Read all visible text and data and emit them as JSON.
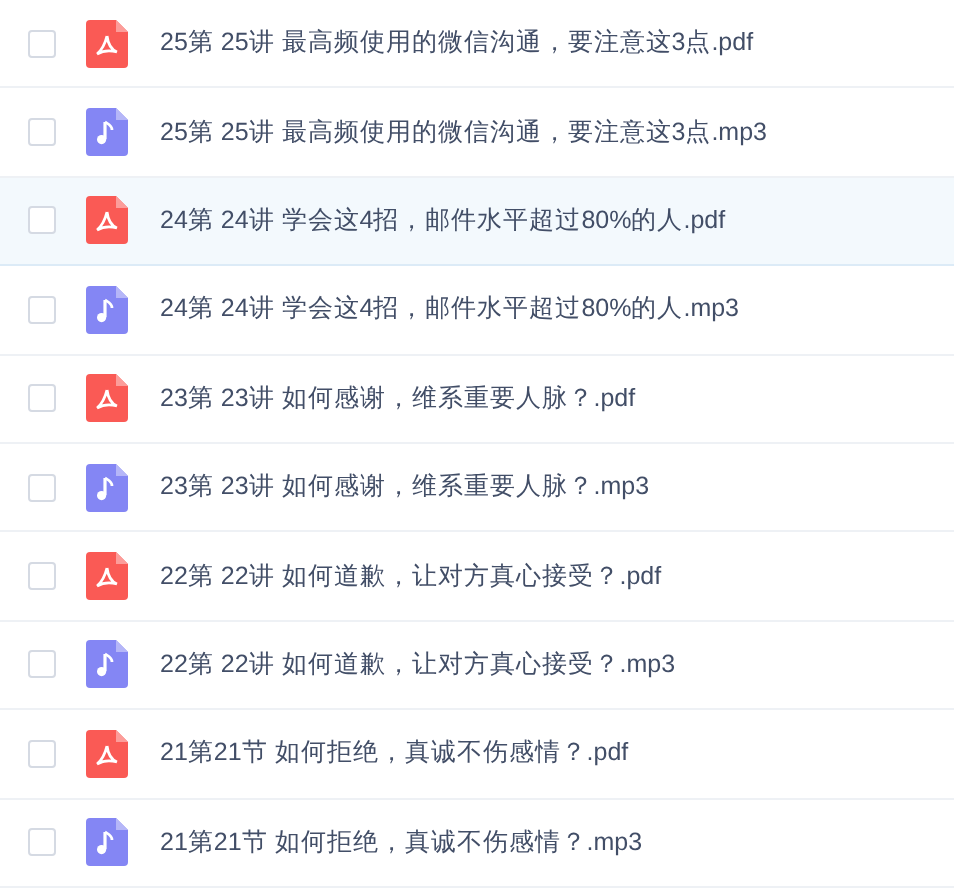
{
  "files": [
    {
      "kind": "pdf",
      "name": "25第 25讲 最高频使用的微信沟通，要注意这3点.pdf",
      "checked": false,
      "selected": false
    },
    {
      "kind": "audio",
      "name": "25第 25讲 最高频使用的微信沟通，要注意这3点.mp3",
      "checked": false,
      "selected": false
    },
    {
      "kind": "pdf",
      "name": "24第 24讲 学会这4招，邮件水平超过80%的人.pdf",
      "checked": false,
      "selected": true
    },
    {
      "kind": "audio",
      "name": "24第 24讲 学会这4招，邮件水平超过80%的人.mp3",
      "checked": false,
      "selected": false
    },
    {
      "kind": "pdf",
      "name": "23第 23讲 如何感谢，维系重要人脉？.pdf",
      "checked": false,
      "selected": false
    },
    {
      "kind": "audio",
      "name": "23第 23讲 如何感谢，维系重要人脉？.mp3",
      "checked": false,
      "selected": false
    },
    {
      "kind": "pdf",
      "name": "22第 22讲 如何道歉，让对方真心接受？.pdf",
      "checked": false,
      "selected": false
    },
    {
      "kind": "audio",
      "name": "22第 22讲 如何道歉，让对方真心接受？.mp3",
      "checked": false,
      "selected": false
    },
    {
      "kind": "pdf",
      "name": "21第21节 如何拒绝，真诚不伤感情？.pdf",
      "checked": false,
      "selected": false
    },
    {
      "kind": "audio",
      "name": "21第21节 如何拒绝，真诚不伤感情？.mp3",
      "checked": false,
      "selected": false
    }
  ]
}
